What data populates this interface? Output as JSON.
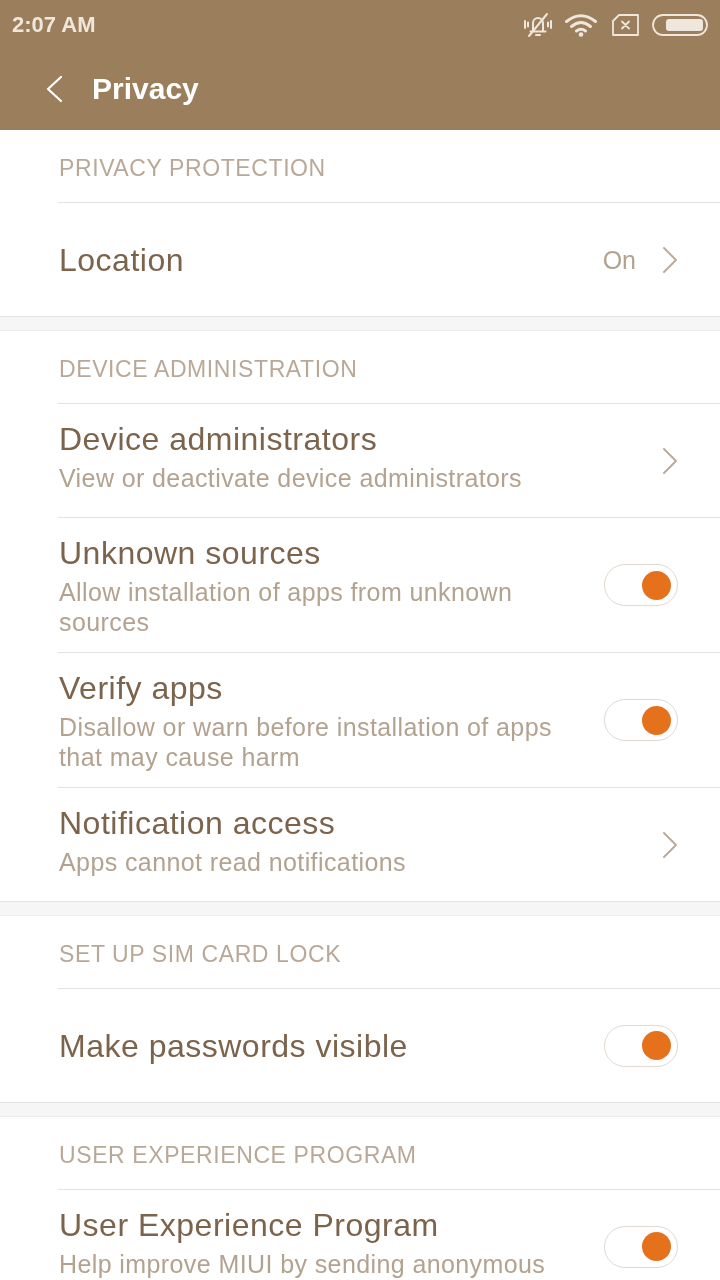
{
  "status_bar": {
    "time": "2:07 AM"
  },
  "toolbar": {
    "title": "Privacy"
  },
  "sections": [
    {
      "title": "PRIVACY PROTECTION",
      "items": [
        {
          "kind": "link",
          "title": "Location",
          "value": "On"
        }
      ]
    },
    {
      "title": "DEVICE ADMINISTRATION",
      "items": [
        {
          "kind": "link",
          "title": "Device administrators",
          "subtitle": "View or deactivate device administrators"
        },
        {
          "kind": "toggle",
          "title": "Unknown sources",
          "subtitle": "Allow installation of apps from unknown sources",
          "on": true
        },
        {
          "kind": "toggle",
          "title": "Verify apps",
          "subtitle": "Disallow or warn before installation of apps that may cause harm",
          "on": true
        },
        {
          "kind": "link",
          "title": "Notification access",
          "subtitle": "Apps cannot read notifications"
        }
      ]
    },
    {
      "title": "SET UP SIM CARD LOCK",
      "items": [
        {
          "kind": "toggle",
          "title": "Make passwords visible",
          "on": true
        }
      ]
    },
    {
      "title": "USER EXPERIENCE PROGRAM",
      "items": [
        {
          "kind": "toggle",
          "title": "User Experience Program",
          "subtitle": "Help improve MIUI by sending anonymous",
          "on": true
        }
      ]
    }
  ]
}
